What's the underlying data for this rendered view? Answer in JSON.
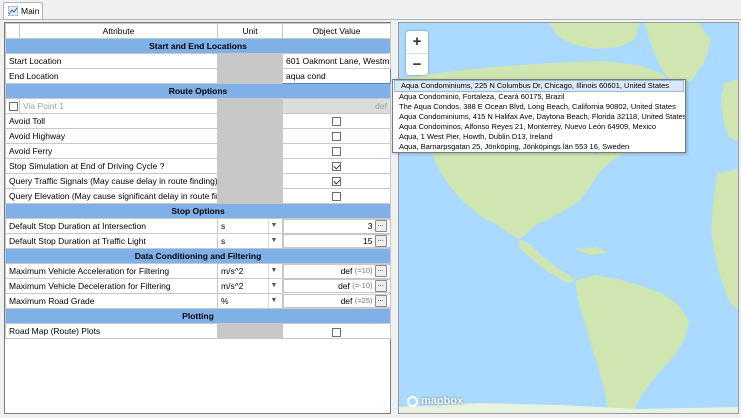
{
  "tab": {
    "label": "Main"
  },
  "table": {
    "headers": {
      "attribute": "Attribute",
      "unit": "Unit",
      "value": "Object Value"
    },
    "sections": {
      "start_end": "Start and End Locations",
      "route": "Route Options",
      "stop": "Stop Options",
      "conditioning": "Data Conditioning and Filtering",
      "plotting": "Plotting"
    },
    "rows": {
      "start_location": {
        "label": "Start Location",
        "value": "601 Oakmont Lane, Westm..."
      },
      "end_location": {
        "label": "End Location",
        "value": "aqua cond"
      },
      "via_point": {
        "label": "Via Point 1",
        "value": "def"
      },
      "avoid_toll": {
        "label": "Avoid Toll",
        "checked": false
      },
      "avoid_highway": {
        "label": "Avoid Highway",
        "checked": false
      },
      "avoid_ferry": {
        "label": "Avoid Ferry",
        "checked": false
      },
      "stop_sim": {
        "label": "Stop Simulation at End of Driving Cycle ?",
        "checked": true
      },
      "query_traffic": {
        "label": "Query Traffic Signals (May cause delay in route finding)",
        "checked": true
      },
      "query_elevation": {
        "label": "Query Elevation (May cause significant delay in route finding)",
        "checked": false
      },
      "stop_intersection": {
        "label": "Default Stop Duration at Intersection",
        "unit": "s",
        "value": "3"
      },
      "stop_traffic_light": {
        "label": "Default Stop Duration at Traffic Light",
        "unit": "s",
        "value": "15"
      },
      "max_accel": {
        "label": "Maximum Vehicle Acceleration for Filtering",
        "unit": "m/s^2",
        "value": "def",
        "hint": "(=10)"
      },
      "max_decel": {
        "label": "Maximum Vehicle Deceleration for Filtering",
        "unit": "m/s^2",
        "value": "def",
        "hint": "(=-10)"
      },
      "max_grade": {
        "label": "Maximum Road Grade",
        "unit": "%",
        "value": "def",
        "hint": "(=25)"
      },
      "road_map": {
        "label": "Road Map (Route) Plots",
        "checked": false
      }
    },
    "ellipsis": "..."
  },
  "map": {
    "zoom_in": "+",
    "zoom_out": "−",
    "attribution": "mapbox"
  },
  "suggestions": [
    "Aqua Condominiums, 225 N Columbus Dr, Chicago, Illinois 60601, United States",
    "Aqua Condominio, Fortaleza, Ceará 60175, Brazil",
    "The Aqua Condos, 388 E Ocean Blvd, Long Beach, California 90802, United States",
    "Aqua Condominiums, 415 N Halifax Ave, Daytona Beach, Florida 32118, United States",
    "Aqua Condominos, Alfonso Reyes 21, Monterrey, Nuevo León 64909, Mexico",
    "Aqua, 1 West Pier, Howth, Dublin D13, Ireland",
    "Aqua, Barnarpsgatan 25, Jönköping, Jönköpings län 553 16, Sweden"
  ],
  "colors": {
    "section_header": "#7fb1e8",
    "ocean": "#aadaff",
    "land": "#cfe6b1"
  }
}
